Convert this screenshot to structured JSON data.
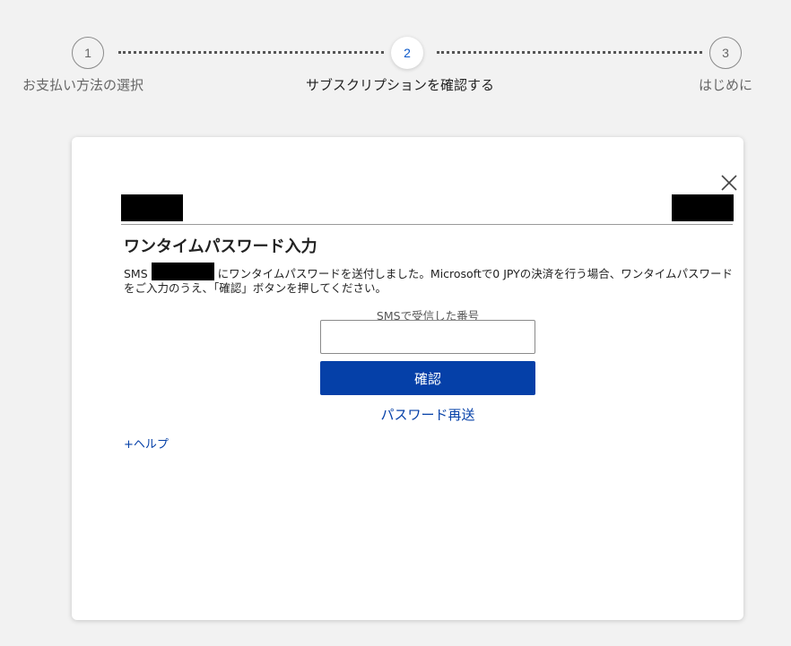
{
  "stepper": {
    "steps": [
      {
        "number": "1",
        "label": "お支払い方法の選択",
        "state": "inactive"
      },
      {
        "number": "2",
        "label": "サブスクリプションを確認する",
        "state": "active"
      },
      {
        "number": "3",
        "label": "はじめに",
        "state": "inactive"
      }
    ]
  },
  "dialog": {
    "title": "ワンタイムパスワード入力",
    "description_prefix": "SMS",
    "description_suffix": "にワンタイムパスワードを送付しました。Microsoftで0 JPYの決済を行う場合、ワンタイムパスワードをご入力のうえ、「確認」ボタンを押してください。",
    "field_label": "SMSで受信した番号",
    "code_input_value": "",
    "confirm_label": "確認",
    "resend_label": "パスワード再送",
    "help_label": "+ヘルプ"
  },
  "colors": {
    "accent": "#0540a8",
    "active_step": "#0a58ca",
    "background": "#f2f2f2"
  }
}
